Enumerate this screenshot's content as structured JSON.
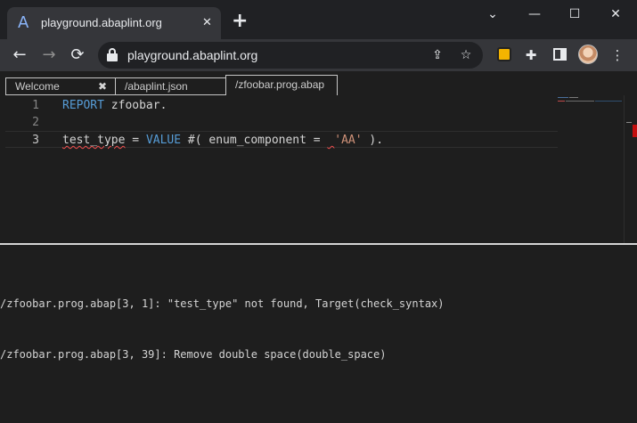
{
  "browser": {
    "tab_title": "playground.abaplint.org",
    "tab_favicon": "A",
    "tab_close": "✕",
    "new_tab": "+",
    "window_controls": {
      "dropdown": "⌄",
      "minimize": "—",
      "maximize": "☐",
      "close": "✕"
    },
    "nav": {
      "back": "←",
      "forward": "→",
      "reload": "⟳"
    },
    "url": "playground.abaplint.org",
    "omnibox_icons": {
      "share": "⇪",
      "bookmark": "☆"
    },
    "toolbar_icons": {
      "extensions": "✚",
      "menu": "⋮"
    }
  },
  "editor_tabs": [
    {
      "label": "Welcome",
      "close": "✖"
    },
    {
      "label": "/abaplint.json"
    },
    {
      "label": "/zfoobar.prog.abap",
      "active": true
    }
  ],
  "editor": {
    "lines": [
      {
        "number": "1",
        "tokens": [
          {
            "text": "REPORT",
            "type": "keyword"
          },
          {
            "text": " zfoobar.",
            "type": "plain"
          }
        ]
      },
      {
        "number": "2",
        "tokens": []
      },
      {
        "number": "3",
        "tokens": [
          {
            "text": "test_type",
            "type": "error"
          },
          {
            "text": " = ",
            "type": "plain"
          },
          {
            "text": "VALUE",
            "type": "keyword"
          },
          {
            "text": " #( enum_component = ",
            "type": "plain"
          },
          {
            "text": " ",
            "type": "error"
          },
          {
            "text": "'AA'",
            "type": "string"
          },
          {
            "text": " ).",
            "type": "plain"
          }
        ]
      }
    ]
  },
  "output": {
    "messages": [
      "/zfoobar.prog.abap[3, 1]: \"test_type\" not found, Target(check_syntax)",
      "/zfoobar.prog.abap[3, 39]: Remove double space(double_space)"
    ]
  },
  "colors": {
    "keyword": "#569cd6",
    "string": "#ce9178",
    "error_squiggle": "#f14c4c",
    "scroll_error_marker": "#c40e0e"
  }
}
